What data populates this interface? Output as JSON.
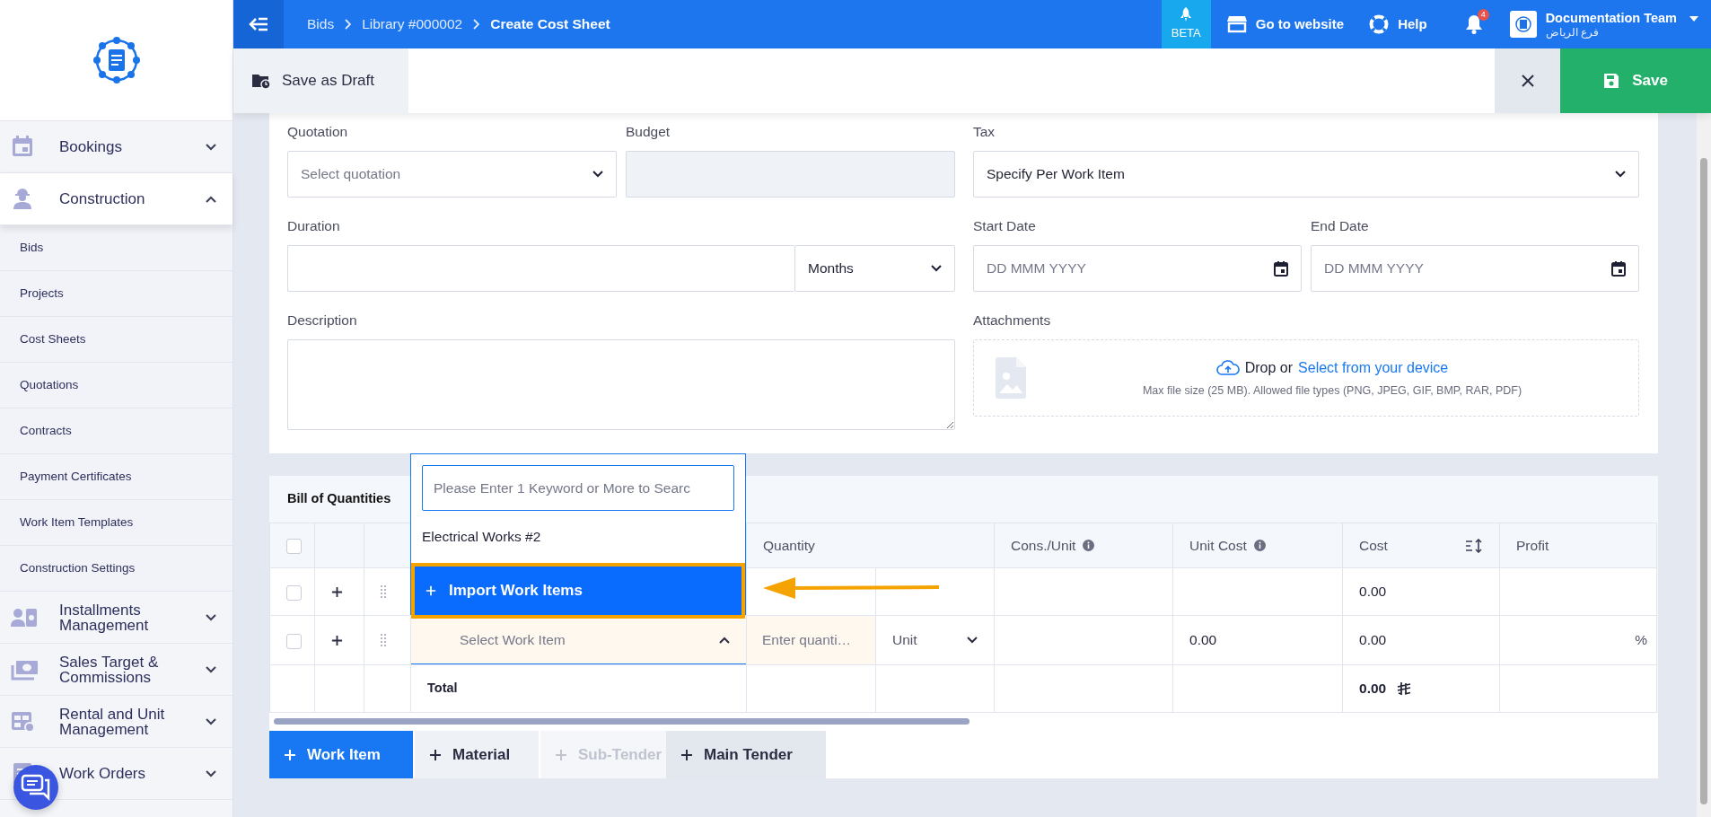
{
  "topbar": {
    "breadcrumbs": [
      {
        "label": "Bids",
        "current": false
      },
      {
        "label": "Library #000002",
        "current": false
      },
      {
        "label": "Create Cost Sheet",
        "current": true
      }
    ],
    "beta": "BETA",
    "links": [
      {
        "label": "Go to website"
      },
      {
        "label": "Help"
      }
    ],
    "notifications": "4",
    "user": {
      "name": "Documentation Team",
      "branch": "فرع الرياض"
    }
  },
  "toolbar": {
    "draft": "Save as Draft",
    "save": "Save"
  },
  "sidebar": {
    "items": [
      {
        "label": "Bookings",
        "expanded": false
      },
      {
        "label": "Construction",
        "expanded": true,
        "children": [
          {
            "label": "Bids"
          },
          {
            "label": "Projects"
          },
          {
            "label": "Cost Sheets"
          },
          {
            "label": "Quotations"
          },
          {
            "label": "Contracts"
          },
          {
            "label": "Payment Certificates"
          },
          {
            "label": "Work Item Templates"
          },
          {
            "label": "Construction Settings"
          }
        ]
      },
      {
        "label": "Installments Management",
        "expanded": false
      },
      {
        "label": "Sales Target & Commissions",
        "expanded": false
      },
      {
        "label": "Rental and Unit Management",
        "expanded": false
      },
      {
        "label": "Work Orders",
        "expanded": false
      }
    ]
  },
  "form": {
    "quotation": {
      "label": "Quotation",
      "placeholder": "Select quotation"
    },
    "budget": {
      "label": "Budget",
      "disabled": true
    },
    "tax": {
      "label": "Tax",
      "value": "Specify Per Work Item"
    },
    "duration": {
      "label": "Duration",
      "unit": "Months"
    },
    "start_date": {
      "label": "Start Date",
      "placeholder": "DD MMM YYYY"
    },
    "end_date": {
      "label": "End Date",
      "placeholder": "DD MMM YYYY"
    },
    "description": {
      "label": "Description"
    },
    "attachments": {
      "label": "Attachments",
      "prompt": "Drop or",
      "link": "Select from your device",
      "hint": "Max file size (25 MB). Allowed file types (PNG, JPEG, GIF, BMP, RAR, PDF)"
    }
  },
  "bill_of_quantities": {
    "title": "Bill of Quantities",
    "all_checked": false,
    "columns": [
      {
        "label": "Quantity",
        "info": false,
        "sort": false
      },
      {
        "label": "Cons./Unit",
        "info": true,
        "sort": false
      },
      {
        "label": "Unit Cost",
        "info": true,
        "sort": false
      },
      {
        "label": "Cost",
        "info": false,
        "sort": true
      },
      {
        "label": "Profit",
        "info": false,
        "sort": false
      }
    ],
    "rows": [
      {
        "kind": "empty",
        "checked": false,
        "cost": "0.00"
      },
      {
        "kind": "entry",
        "checked": false,
        "item_placeholder": "Select Work Item",
        "quantity_placeholder": "Enter quanti…",
        "unit": "Unit",
        "unit_cost": "0.00",
        "cost": "0.00",
        "profit_suffix": "%"
      }
    ],
    "total": {
      "label": "Total",
      "cost": "0.00"
    },
    "dropdown": {
      "search_placeholder": "Please Enter 1 Keyword or More to Searc",
      "options": [
        {
          "label": "Electrical Works #2",
          "kind": "item",
          "selected": false
        },
        {
          "label": "Import Work Items",
          "kind": "action",
          "selected": true
        }
      ]
    },
    "add_buttons": [
      {
        "label": "Work Item",
        "kind": "primary",
        "disabled": false
      },
      {
        "label": "Material",
        "kind": "secondary",
        "disabled": false
      },
      {
        "label": "Sub-Tender",
        "kind": "secondary",
        "disabled": true
      },
      {
        "label": "Main Tender",
        "kind": "tertiary",
        "disabled": false
      }
    ]
  }
}
